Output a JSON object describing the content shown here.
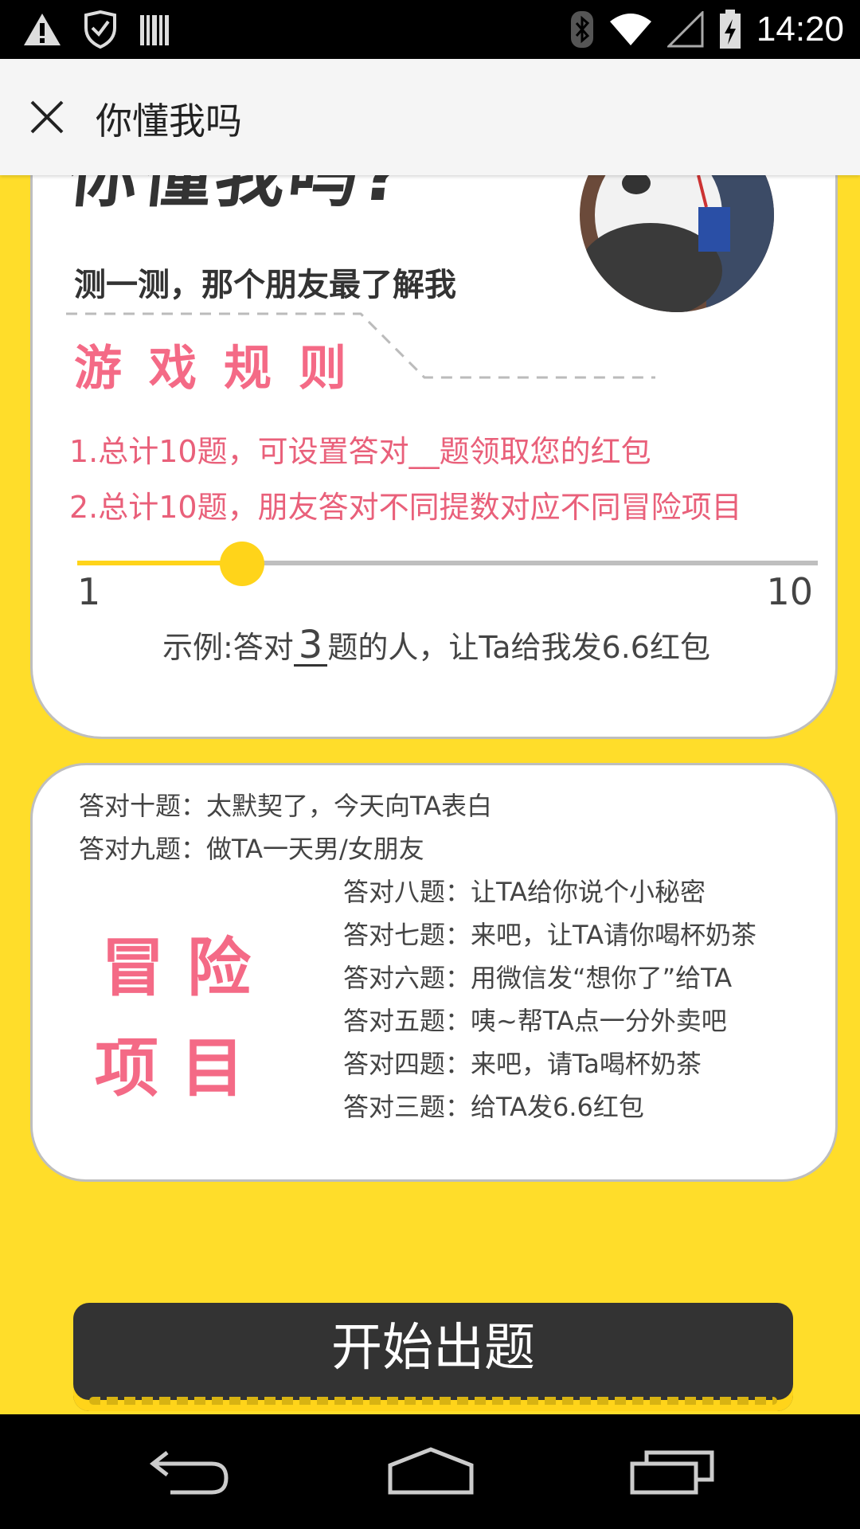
{
  "status_bar": {
    "time": "14:20",
    "left_icons": [
      "warning-icon",
      "shield-icon",
      "barcode-icon"
    ],
    "right_icons": [
      "bluetooth-icon",
      "wifi-icon",
      "signal-icon",
      "battery-icon"
    ]
  },
  "app_bar": {
    "title": "你懂我吗",
    "close_icon": "close-icon"
  },
  "banner": {
    "title": "你懂我吗?",
    "subtitle": "测一测，那个朋友最了解我"
  },
  "rules": {
    "heading": "游戏规则",
    "items": [
      "1.总计10题，可设置答对__题领取您的红包",
      "2.总计10题，朋友答对不同提数对应不同冒险项目"
    ]
  },
  "slider": {
    "min_label": "1",
    "max_label": "10",
    "value": 3,
    "min": 1,
    "max": 10
  },
  "example": {
    "prefix": "示例:答对",
    "number": "3",
    "suffix": "题的人，让Ta给我发6.6红包"
  },
  "adventure": {
    "title_line1": "冒 险",
    "title_line2": "项 目",
    "top_items": [
      "答对十题：太默契了，今天向TA表白",
      "答对九题：做TA一天男/女朋友"
    ],
    "side_items": [
      "答对八题：让TA给你说个小秘密",
      "答对七题：来吧，让TA请你喝杯奶茶",
      "答对六题：用微信发“想你了”给TA",
      "答对五题：咦~帮TA点一分外卖吧",
      "答对四题：来吧，请Ta喝杯奶茶",
      "答对三题：给TA发6.6红包"
    ]
  },
  "start_button": {
    "label": "开始出题"
  },
  "colors": {
    "background": "#FFDD2A",
    "accent_pink": "#F46A86",
    "button_dark": "#333333",
    "slider_yellow": "#FFD41A"
  },
  "nav_bar": {
    "icons": [
      "back-icon",
      "home-icon",
      "recents-icon"
    ]
  }
}
